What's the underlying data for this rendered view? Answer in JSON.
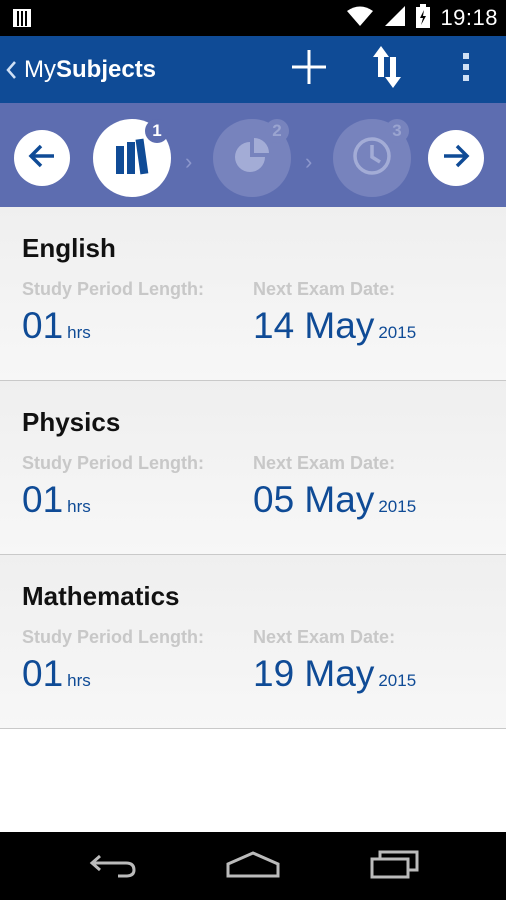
{
  "status_bar": {
    "time": "19:18"
  },
  "action_bar": {
    "title_light": "My",
    "title_bold": "Subjects"
  },
  "steps": [
    {
      "number": "1",
      "icon": "books-icon",
      "active": true
    },
    {
      "number": "2",
      "icon": "pie-chart-icon",
      "active": false
    },
    {
      "number": "3",
      "icon": "clock-icon",
      "active": false
    }
  ],
  "subjects": [
    {
      "name": "English",
      "study_label": "Study Period Length:",
      "study_value": "01",
      "study_unit": "hrs",
      "exam_label": "Next Exam Date:",
      "exam_date": "14 May",
      "exam_year": "2015"
    },
    {
      "name": "Physics",
      "study_label": "Study Period Length:",
      "study_value": "01",
      "study_unit": "hrs",
      "exam_label": "Next Exam Date:",
      "exam_date": "05 May",
      "exam_year": "2015"
    },
    {
      "name": "Mathematics",
      "study_label": "Study Period Length:",
      "study_value": "01",
      "study_unit": "hrs",
      "exam_label": "Next Exam Date:",
      "exam_date": "19 May",
      "exam_year": "2015"
    }
  ],
  "colors": {
    "primary": "#0f4b96",
    "steps_bg": "#5d6db0",
    "label_gray": "#c8c8c8"
  }
}
